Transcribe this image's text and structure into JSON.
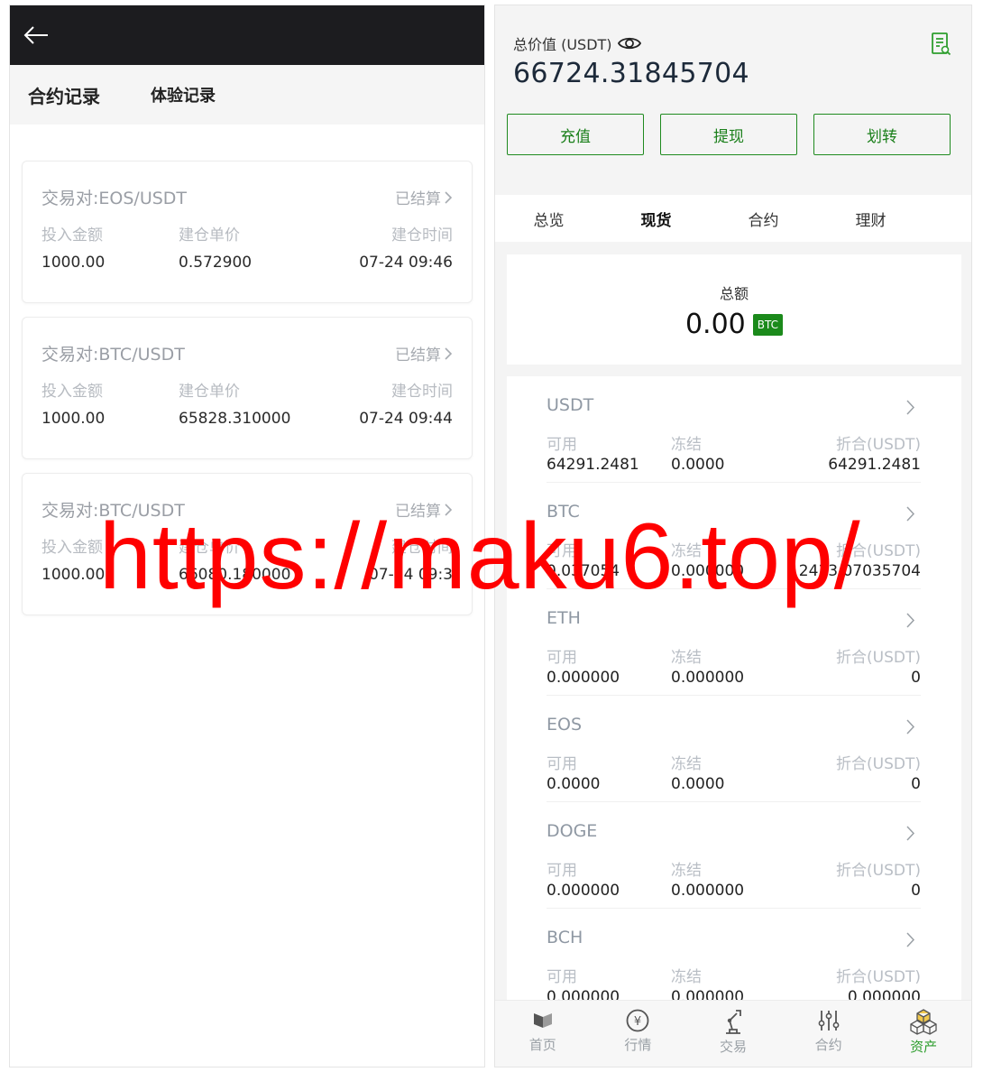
{
  "left": {
    "tabs": {
      "contract": "合约记录",
      "trial": "体验记录"
    },
    "records": [
      {
        "pair": "交易对:EOS/USDT",
        "status": "已结算",
        "labels": [
          "投入金额",
          "建仓单价",
          "建仓时间"
        ],
        "values": [
          "1000.00",
          "0.572900",
          "07-24 09:46"
        ]
      },
      {
        "pair": "交易对:BTC/USDT",
        "status": "已结算",
        "labels": [
          "投入金额",
          "建仓单价",
          "建仓时间"
        ],
        "values": [
          "1000.00",
          "65828.310000",
          "07-24 09:44"
        ]
      },
      {
        "pair": "交易对:BTC/USDT",
        "status": "已结算",
        "labels": [
          "投入金额",
          "建仓单价",
          "建仓时间"
        ],
        "values": [
          "1000.00",
          "66080.180000",
          "07-24 09:3"
        ]
      }
    ]
  },
  "right": {
    "balance_label": "总价值 (USDT)",
    "balance_value": "66724.31845704",
    "actions": [
      "充值",
      "提现",
      "划转"
    ],
    "tabs": [
      "总览",
      "现货",
      "合约",
      "理财"
    ],
    "active_tab": "现货",
    "total_label": "总额",
    "total_value": "0.00",
    "total_unit": "BTC",
    "asset_labels": [
      "可用",
      "冻结",
      "折合(USDT)"
    ],
    "assets": [
      {
        "name": "USDT",
        "available": "64291.2481",
        "frozen": "0.0000",
        "usdt": "64291.2481"
      },
      {
        "name": "BTC",
        "available": "0.037054",
        "frozen": "0.000000",
        "usdt": "2433.07035704"
      },
      {
        "name": "ETH",
        "available": "0.000000",
        "frozen": "0.000000",
        "usdt": "0"
      },
      {
        "name": "EOS",
        "available": "0.0000",
        "frozen": "0.0000",
        "usdt": "0"
      },
      {
        "name": "DOGE",
        "available": "0.000000",
        "frozen": "0.000000",
        "usdt": "0"
      },
      {
        "name": "BCH",
        "available": "0.000000",
        "frozen": "0.000000",
        "usdt": "0.000000"
      }
    ],
    "nav": [
      "首页",
      "行情",
      "交易",
      "合约",
      "资产"
    ],
    "active_nav": "资产",
    "accent_color": "#1b8a1b"
  },
  "watermark": "https://maku6.top/"
}
